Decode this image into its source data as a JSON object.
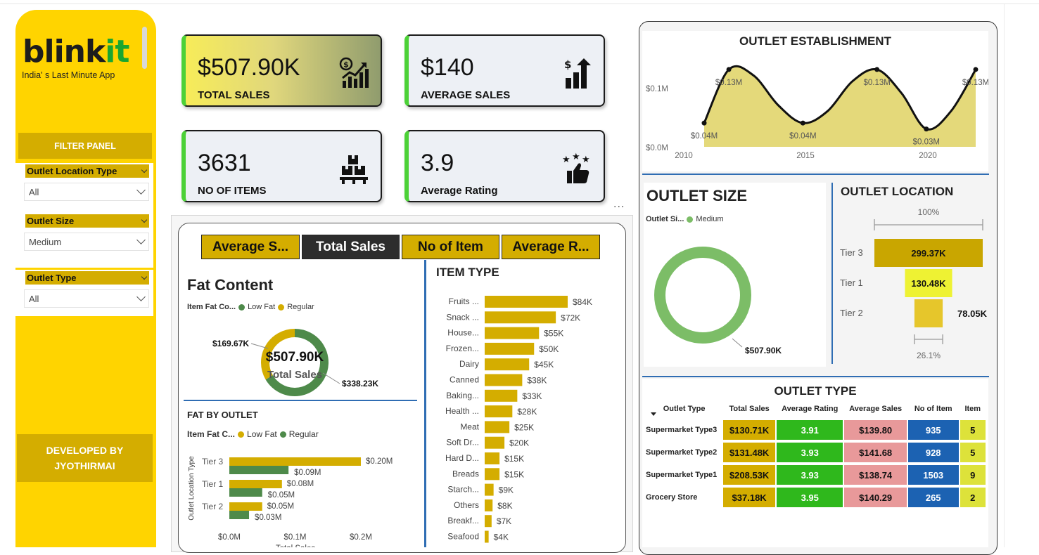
{
  "brand": {
    "logo_main": "blink",
    "logo_accent": "it",
    "tagline": "India' s Last Minute App"
  },
  "filters": {
    "panel_title": "FILTER PANEL",
    "location": {
      "label": "Outlet Location Type",
      "value": "All"
    },
    "size": {
      "label": "Outlet Size",
      "value": "Medium"
    },
    "type": {
      "label": "Outlet Type",
      "value": "All"
    }
  },
  "developer": {
    "line1": "DEVELOPED BY",
    "line2": "JYOTHIRMAI"
  },
  "kpis": [
    {
      "value": "$507.90K",
      "label": "TOTAL SALES",
      "icon": "money-growth-icon"
    },
    {
      "value": "$140",
      "label": "AVERAGE SALES",
      "icon": "bar-growth-icon"
    },
    {
      "value": "3631",
      "label": "NO OF ITEMS",
      "icon": "boxes-icon"
    },
    {
      "value": "3.9",
      "label": "Average Rating",
      "icon": "rating-stars-icon"
    }
  ],
  "tabs": [
    "Average S...",
    "Total Sales",
    "No of Item",
    "Average R..."
  ],
  "active_tab": "Total Sales",
  "more_options": "...",
  "colors": {
    "yellow": "#ffd400",
    "gold": "#d4ad00",
    "green_dark": "#4e8a4a",
    "green_light": "#7cbd67",
    "bar_gold": "#d4ad00",
    "olive": "#e4d97a"
  },
  "chart_data": [
    {
      "id": "fat_content",
      "type": "pie",
      "title": "Fat Content",
      "legend_title": "Item Fat Co...",
      "center_value": "$507.90K",
      "center_label": "Total Sales",
      "categories": [
        "Low Fat",
        "Regular"
      ],
      "values": [
        338.23,
        169.67
      ],
      "labels": [
        "$338.23K",
        "$169.67K"
      ]
    },
    {
      "id": "fat_by_outlet",
      "type": "bar",
      "title": "FAT BY OUTLET",
      "legend_title": "Item Fat C...",
      "ylabel": "Outlet Location Type",
      "xlabel": "Total Sales",
      "categories": [
        "Tier 3",
        "Tier 1",
        "Tier 2"
      ],
      "series": [
        {
          "name": "Low Fat",
          "values": [
            0.2,
            0.08,
            0.05
          ],
          "labels": [
            "$0.20M",
            "$0.08M",
            "$0.05M"
          ]
        },
        {
          "name": "Regular",
          "values": [
            0.09,
            0.05,
            0.03
          ],
          "labels": [
            "$0.09M",
            "$0.05M",
            "$0.03M"
          ]
        }
      ],
      "xticks": [
        "$0.0M",
        "$0.1M",
        "$0.2M"
      ],
      "xlim": [
        0,
        0.2
      ]
    },
    {
      "id": "item_type",
      "type": "bar",
      "title": "ITEM TYPE",
      "categories": [
        "Fruits ...",
        "Snack ...",
        "House...",
        "Frozen...",
        "Dairy",
        "Canned",
        "Baking...",
        "Health ...",
        "Meat",
        "Soft Dr...",
        "Hard D...",
        "Breads",
        "Starch...",
        "Others",
        "Breakf...",
        "Seafood"
      ],
      "values": [
        84,
        72,
        55,
        50,
        45,
        38,
        33,
        28,
        25,
        20,
        15,
        15,
        9,
        8,
        7,
        4
      ],
      "labels": [
        "$84K",
        "$72K",
        "$55K",
        "$50K",
        "$45K",
        "$38K",
        "$33K",
        "$28K",
        "$25K",
        "$20K",
        "$15K",
        "$15K",
        "$9K",
        "$8K",
        "$7K",
        "$4K"
      ]
    },
    {
      "id": "outlet_establishment",
      "type": "area",
      "title": "OUTLET ESTABLISHMENT",
      "x": [
        2011,
        2012,
        2013,
        2014,
        2015,
        2016,
        2017,
        2018,
        2019,
        2020,
        2021,
        2022
      ],
      "values": [
        0.04,
        0.13,
        0.12,
        0.07,
        0.04,
        0.06,
        0.11,
        0.13,
        0.09,
        0.03,
        0.06,
        0.13
      ],
      "point_labels": [
        "$0.04M",
        "$0.13M",
        "",
        "",
        "$0.04M",
        "",
        "",
        "$0.13M",
        "",
        "$0.03M",
        "",
        "$0.13M"
      ],
      "xticks": [
        "2010",
        "2015",
        "2020"
      ],
      "yticks": [
        "$0.0M",
        "$0.1M"
      ],
      "ylim": [
        0,
        0.15
      ]
    },
    {
      "id": "outlet_size",
      "type": "pie",
      "title": "OUTLET SIZE",
      "legend_title": "Outlet Si...",
      "categories": [
        "Medium"
      ],
      "values": [
        507.9
      ],
      "labels": [
        "$507.90K"
      ]
    },
    {
      "id": "outlet_location",
      "type": "bar",
      "title": "OUTLET LOCATION",
      "categories": [
        "Tier 3",
        "Tier 1",
        "Tier 2"
      ],
      "values": [
        299.37,
        130.48,
        78.05
      ],
      "labels": [
        "299.37K",
        "130.48K",
        "78.05K"
      ],
      "top_label": "100%",
      "bottom_label": "26.1%"
    }
  ],
  "outlet_type_table": {
    "title": "OUTLET TYPE",
    "headers": [
      "Outlet Type",
      "Total Sales",
      "Average Rating",
      "Average Sales",
      "No of Item",
      "Item"
    ],
    "rows": [
      {
        "type": "Supermarket Type3",
        "sales": "$130.71K",
        "rating": "3.91",
        "avg": "$139.80",
        "items": "935",
        "vis": "5"
      },
      {
        "type": "Supermarket Type2",
        "sales": "$131.48K",
        "rating": "3.93",
        "avg": "$141.68",
        "items": "928",
        "vis": "5"
      },
      {
        "type": "Supermarket Type1",
        "sales": "$208.53K",
        "rating": "3.93",
        "avg": "$138.74",
        "items": "1503",
        "vis": "9"
      },
      {
        "type": "Grocery Store",
        "sales": "$37.18K",
        "rating": "3.95",
        "avg": "$140.29",
        "items": "265",
        "vis": "2"
      }
    ]
  }
}
